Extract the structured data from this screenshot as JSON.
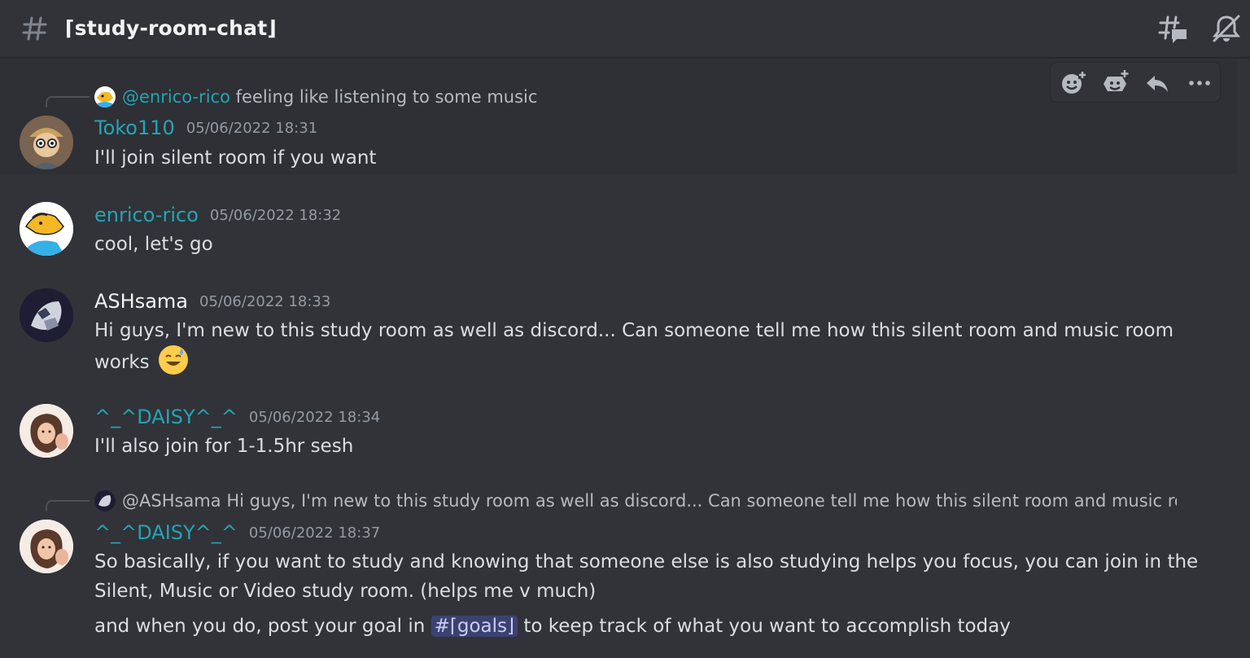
{
  "channel": {
    "name": "⌈study-room-chat⌋"
  },
  "messages": [
    {
      "reply": {
        "mention": "@enrico-rico",
        "text": "feeling like listening to some music"
      },
      "author": "Toko110",
      "author_color": "#23a5b5",
      "time": "05/06/2022 18:31",
      "text": "I'll join silent room if you want"
    },
    {
      "author": "enrico-rico",
      "author_color": "#23a5b5",
      "time": "05/06/2022 18:32",
      "text": "cool, let's go"
    },
    {
      "author": "ASHsama",
      "author_color": "#f2f3f5",
      "time": "05/06/2022 18:33",
      "lines": [
        "Hi guys, I'm new to this study room as well as discord... Can someone tell me how this silent room and music room",
        "works"
      ]
    },
    {
      "author": "^_^DAISY^_^",
      "author_color": "#23a5b5",
      "time": "05/06/2022 18:34",
      "text": "I'll also join for 1-1.5hr sesh"
    },
    {
      "reply": {
        "mention": "@ASHsama",
        "text": "Hi guys, I'm new to this study room as well as discord... Can someone tell me how this silent room and music room works"
      },
      "author": "^_^DAISY^_^",
      "author_color": "#23a5b5",
      "time": "05/06/2022 18:37",
      "lines": [
        "So basically, if you want to study and knowing that someone else is also studying helps you focus, you can join in the",
        "Silent, Music or Video study room. (helps me v much)"
      ],
      "followup_before": "and when you do, post your goal in",
      "followup_channel": "#⌈goals⌋",
      "followup_after": "to keep track of what you want to accomplish today"
    }
  ],
  "icons": {
    "header": [
      "hash-icon",
      "threads-icon",
      "mute-icon"
    ],
    "toolbar": [
      "add-reaction-icon",
      "add-super-reaction-icon",
      "reply-icon",
      "more-icon"
    ]
  }
}
